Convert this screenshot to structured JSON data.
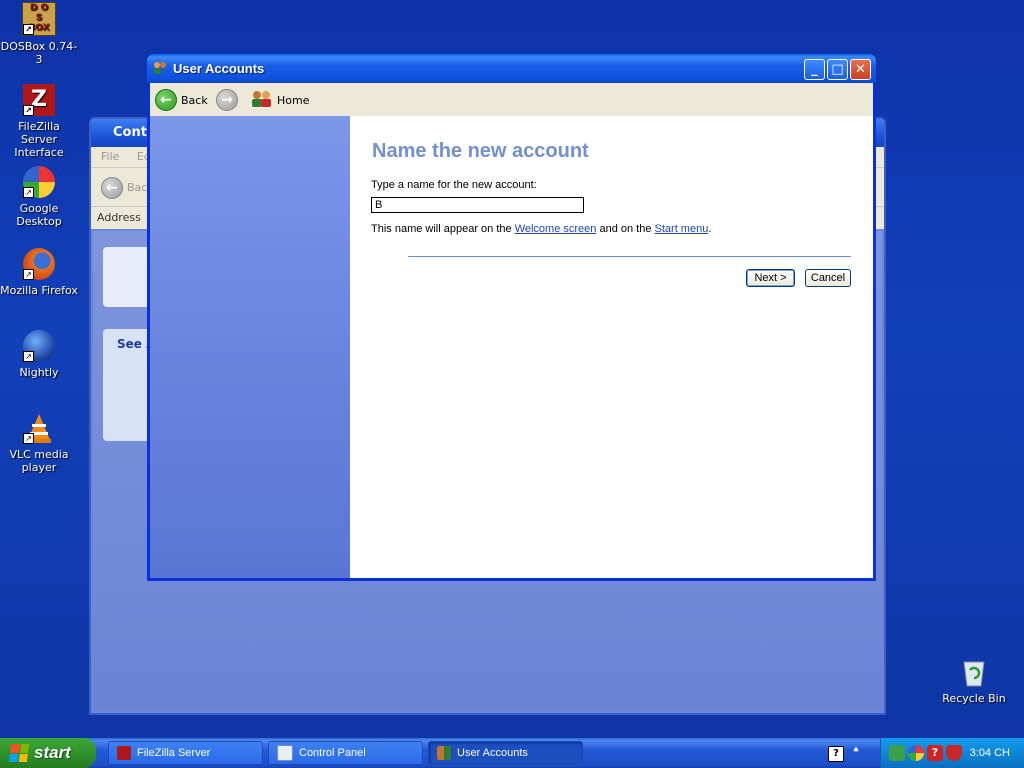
{
  "desktop": {
    "icons": [
      {
        "label": "DOSBox 0.74-3",
        "icon": "dosbox-icon"
      },
      {
        "label": "FileZilla Server Interface",
        "icon": "filezilla-icon"
      },
      {
        "label": "Google Desktop",
        "icon": "google-desktop-icon"
      },
      {
        "label": "Mozilla Firefox",
        "icon": "firefox-icon"
      },
      {
        "label": "Nightly",
        "icon": "nightly-icon"
      },
      {
        "label": "VLC media player",
        "icon": "vlc-icon"
      }
    ],
    "recycle_bin": {
      "label": "Recycle Bin",
      "icon": "recycle-bin-icon"
    }
  },
  "control_panel_window": {
    "title": "Contr",
    "menu_file": "File",
    "menu_edit": "Ed",
    "back": "Bac",
    "address": "Address",
    "see_also": "See A"
  },
  "user_accounts_window": {
    "title": "User Accounts",
    "nav": {
      "back": "Back",
      "home": "Home"
    },
    "heading": "Name the new account",
    "prompt": "Type a name for the new account:",
    "name_value": "B",
    "note_prefix": "This name will appear on the ",
    "note_link1": "Welcome screen",
    "note_middle": " and on the ",
    "note_link2": "Start menu",
    "note_suffix": ".",
    "next_button": "Next >",
    "cancel_button": "Cancel"
  },
  "taskbar": {
    "start": "start",
    "items": [
      {
        "label": "FileZilla Server",
        "active": false
      },
      {
        "label": "Control Panel",
        "active": false
      },
      {
        "label": "User Accounts",
        "active": true
      }
    ],
    "clock": "3:04 CH"
  },
  "colors": {
    "desktop": "#0d32a8",
    "heading": "#7391cf",
    "link": "#1f47b5",
    "side_pane": "#6c88e0"
  }
}
